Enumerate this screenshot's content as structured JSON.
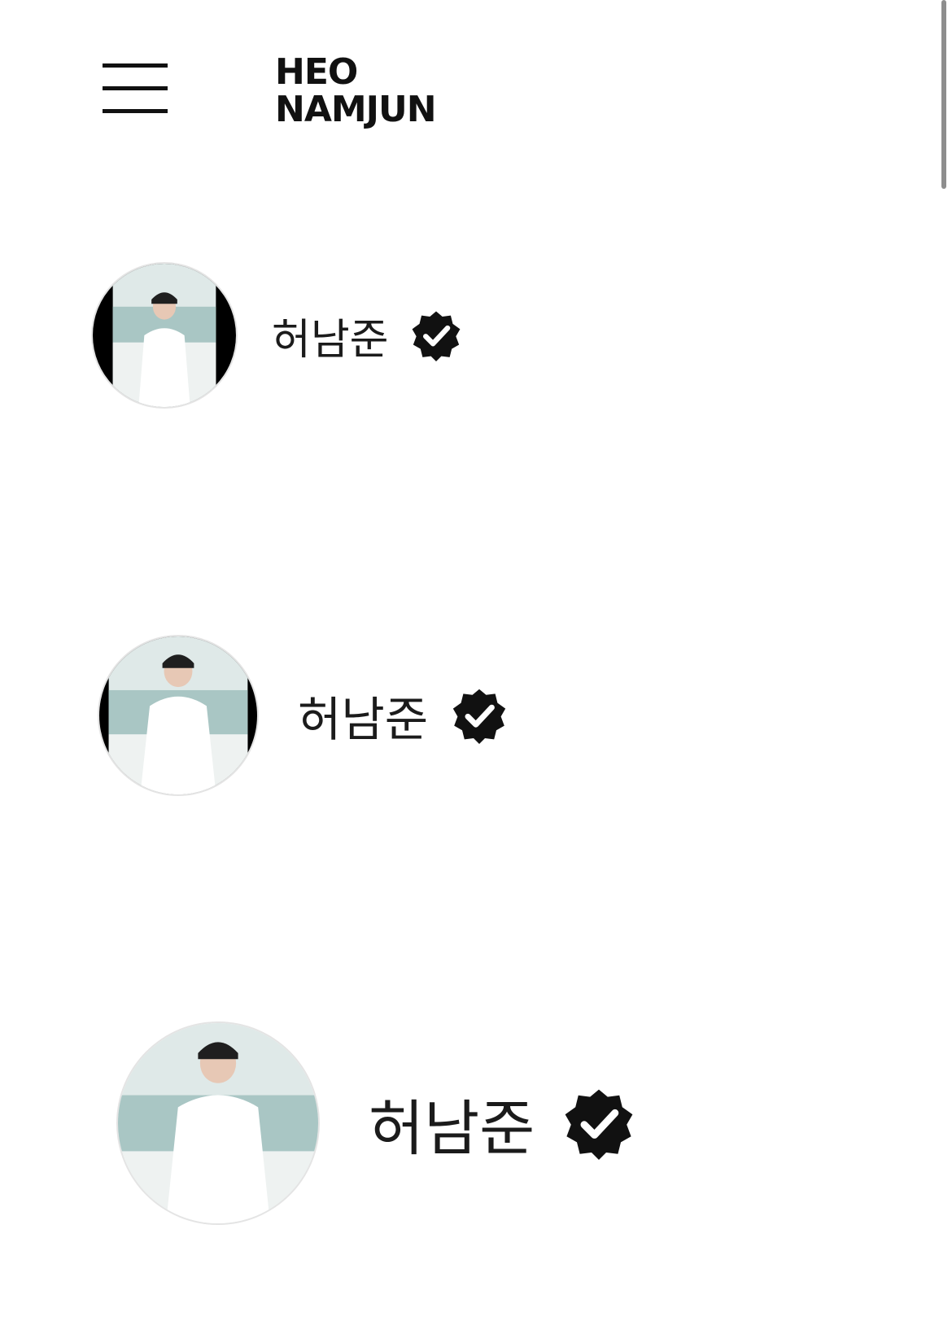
{
  "header": {
    "menu_icon": "hamburger-menu-icon",
    "brand_line1": "HEO",
    "brand_line2": "NAMJUN"
  },
  "profiles": [
    {
      "name": "허남준",
      "verified_icon": "verified-badge-icon",
      "avatar_icon": "profile-photo"
    },
    {
      "name": "허남준",
      "verified_icon": "verified-badge-icon",
      "avatar_icon": "profile-photo"
    },
    {
      "name": "허남준",
      "verified_icon": "verified-badge-icon",
      "avatar_icon": "profile-photo"
    }
  ],
  "colors": {
    "background": "#ffffff",
    "text": "#111111",
    "badge": "#111111",
    "scrollbar": "#8e8e8e"
  }
}
